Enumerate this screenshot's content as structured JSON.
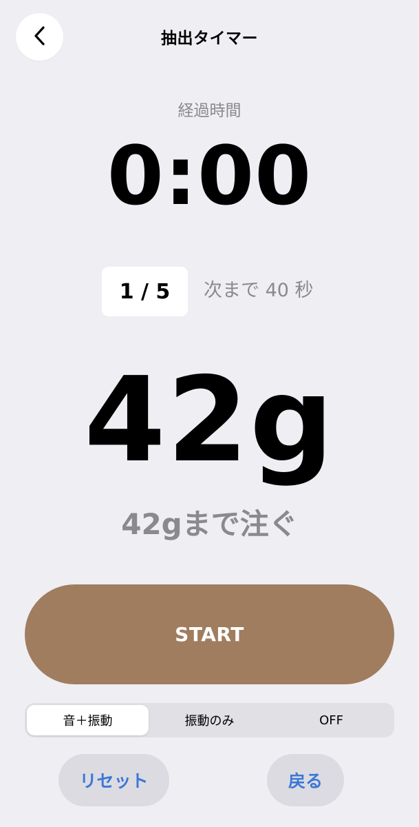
{
  "header": {
    "back_icon": "chevron-left-icon",
    "title": "抽出タイマー"
  },
  "timer": {
    "elapsed_label": "経過時間",
    "elapsed_time": "0:00"
  },
  "step": {
    "badge": "1 / 5",
    "next_info": "次まで 40 秒"
  },
  "pour": {
    "target": "42g",
    "instruction": "42gまで注ぐ"
  },
  "start_button": {
    "label": "START"
  },
  "alert_mode": {
    "options": [
      "音＋振動",
      "振動のみ",
      "OFF"
    ],
    "selected": "音＋振動"
  },
  "footer": {
    "reset_label": "リセット",
    "back_label": "戻る"
  },
  "colors": {
    "background": "#efeef3",
    "accent_brown": "#a07d5f",
    "link_blue": "#3b78d8",
    "secondary_text": "#8a8a8e"
  }
}
